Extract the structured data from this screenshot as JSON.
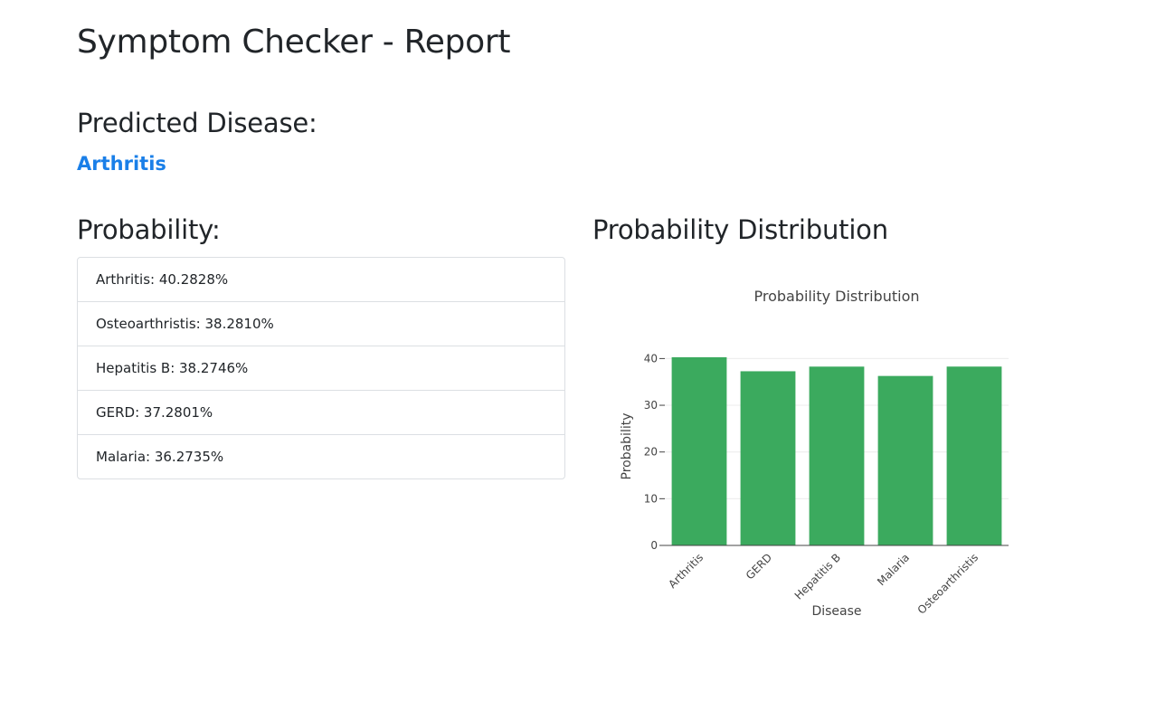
{
  "page": {
    "title": "Symptom Checker - Report"
  },
  "prediction": {
    "heading": "Predicted Disease:",
    "disease": "Arthritis"
  },
  "probability": {
    "heading": "Probability:",
    "items": [
      "Arthritis: 40.2828%",
      "Osteoarthristis: 38.2810%",
      "Hepatitis B: 38.2746%",
      "GERD: 37.2801%",
      "Malaria: 36.2735%"
    ]
  },
  "distribution": {
    "heading": "Probability Distribution"
  },
  "colors": {
    "accent": "#1a7fe8",
    "bar": "#3baa5e"
  },
  "chart_data": {
    "type": "bar",
    "title": "Probability Distribution",
    "xlabel": "Disease",
    "ylabel": "Probability",
    "categories": [
      "Arthritis",
      "GERD",
      "Hepatitis B",
      "Malaria",
      "Osteoarthristis"
    ],
    "values": [
      40.2828,
      37.2801,
      38.2746,
      36.2735,
      38.281
    ],
    "ylim": [
      0,
      42.4
    ],
    "yticks": [
      0,
      10,
      20,
      30,
      40
    ],
    "grid": true,
    "legend": "none"
  }
}
